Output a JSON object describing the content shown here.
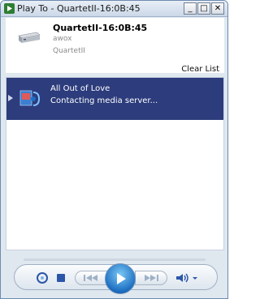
{
  "window": {
    "title": "Play To - QuartetII-16:0B:45",
    "minimize_label": "_",
    "maximize_label": "□",
    "close_label": "✕"
  },
  "device": {
    "name": "QuartetII-16:0B:45",
    "manufacturer": "awox",
    "model": "QuartetII",
    "icon": "media-receiver-icon"
  },
  "clear_list_label": "Clear List",
  "playlist": {
    "items": [
      {
        "title": "All Out of Love",
        "status": "Contacting media server...",
        "selected": true,
        "icon": "music-file-icon"
      }
    ]
  },
  "controls": {
    "shuffle_icon": "repeat-icon",
    "stop_icon": "stop-icon",
    "prev_icon": "previous-track-icon",
    "play_icon": "play-icon",
    "next_icon": "next-track-icon",
    "volume_icon": "volume-icon",
    "accent": "#2c3c7c",
    "play_color": "#1d6fc2"
  }
}
